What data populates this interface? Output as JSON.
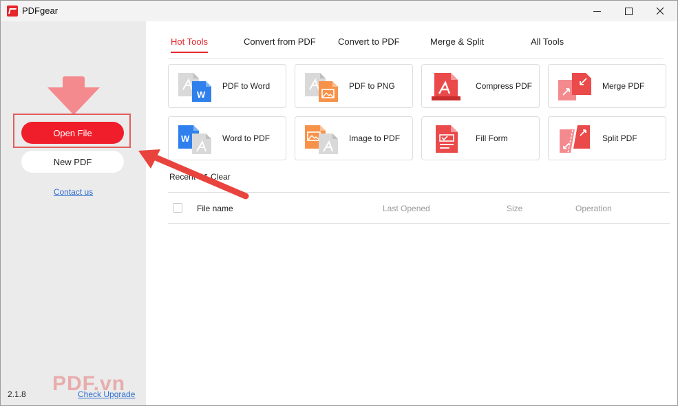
{
  "app": {
    "title": "PDFgear"
  },
  "sidebar": {
    "open_file": "Open File",
    "new_pdf": "New PDF",
    "contact": "Contact us",
    "version": "2.1.8",
    "check_upgrade": "Check Upgrade",
    "watermark": "PDF.vn"
  },
  "tabs": [
    {
      "label": "Hot Tools",
      "active": true
    },
    {
      "label": "Convert from PDF",
      "active": false
    },
    {
      "label": "Convert to PDF",
      "active": false
    },
    {
      "label": "Merge & Split",
      "active": false
    },
    {
      "label": "All Tools",
      "active": false
    }
  ],
  "tools": [
    {
      "label": "PDF to Word",
      "icon": "pdf-to-word-icon"
    },
    {
      "label": "PDF to PNG",
      "icon": "pdf-to-png-icon"
    },
    {
      "label": "Compress PDF",
      "icon": "compress-pdf-icon"
    },
    {
      "label": "Merge PDF",
      "icon": "merge-pdf-icon"
    },
    {
      "label": "Word to PDF",
      "icon": "word-to-pdf-icon"
    },
    {
      "label": "Image to PDF",
      "icon": "image-to-pdf-icon"
    },
    {
      "label": "Fill Form",
      "icon": "fill-form-icon"
    },
    {
      "label": "Split PDF",
      "icon": "split-pdf-icon"
    }
  ],
  "recent": {
    "label": "Recent",
    "clear": "Clear",
    "columns": [
      "File name",
      "Last Opened",
      "Size",
      "Operation"
    ]
  },
  "colors": {
    "accent": "#e5262b",
    "button_red": "#f01d2a",
    "link": "#2f6fd1"
  }
}
